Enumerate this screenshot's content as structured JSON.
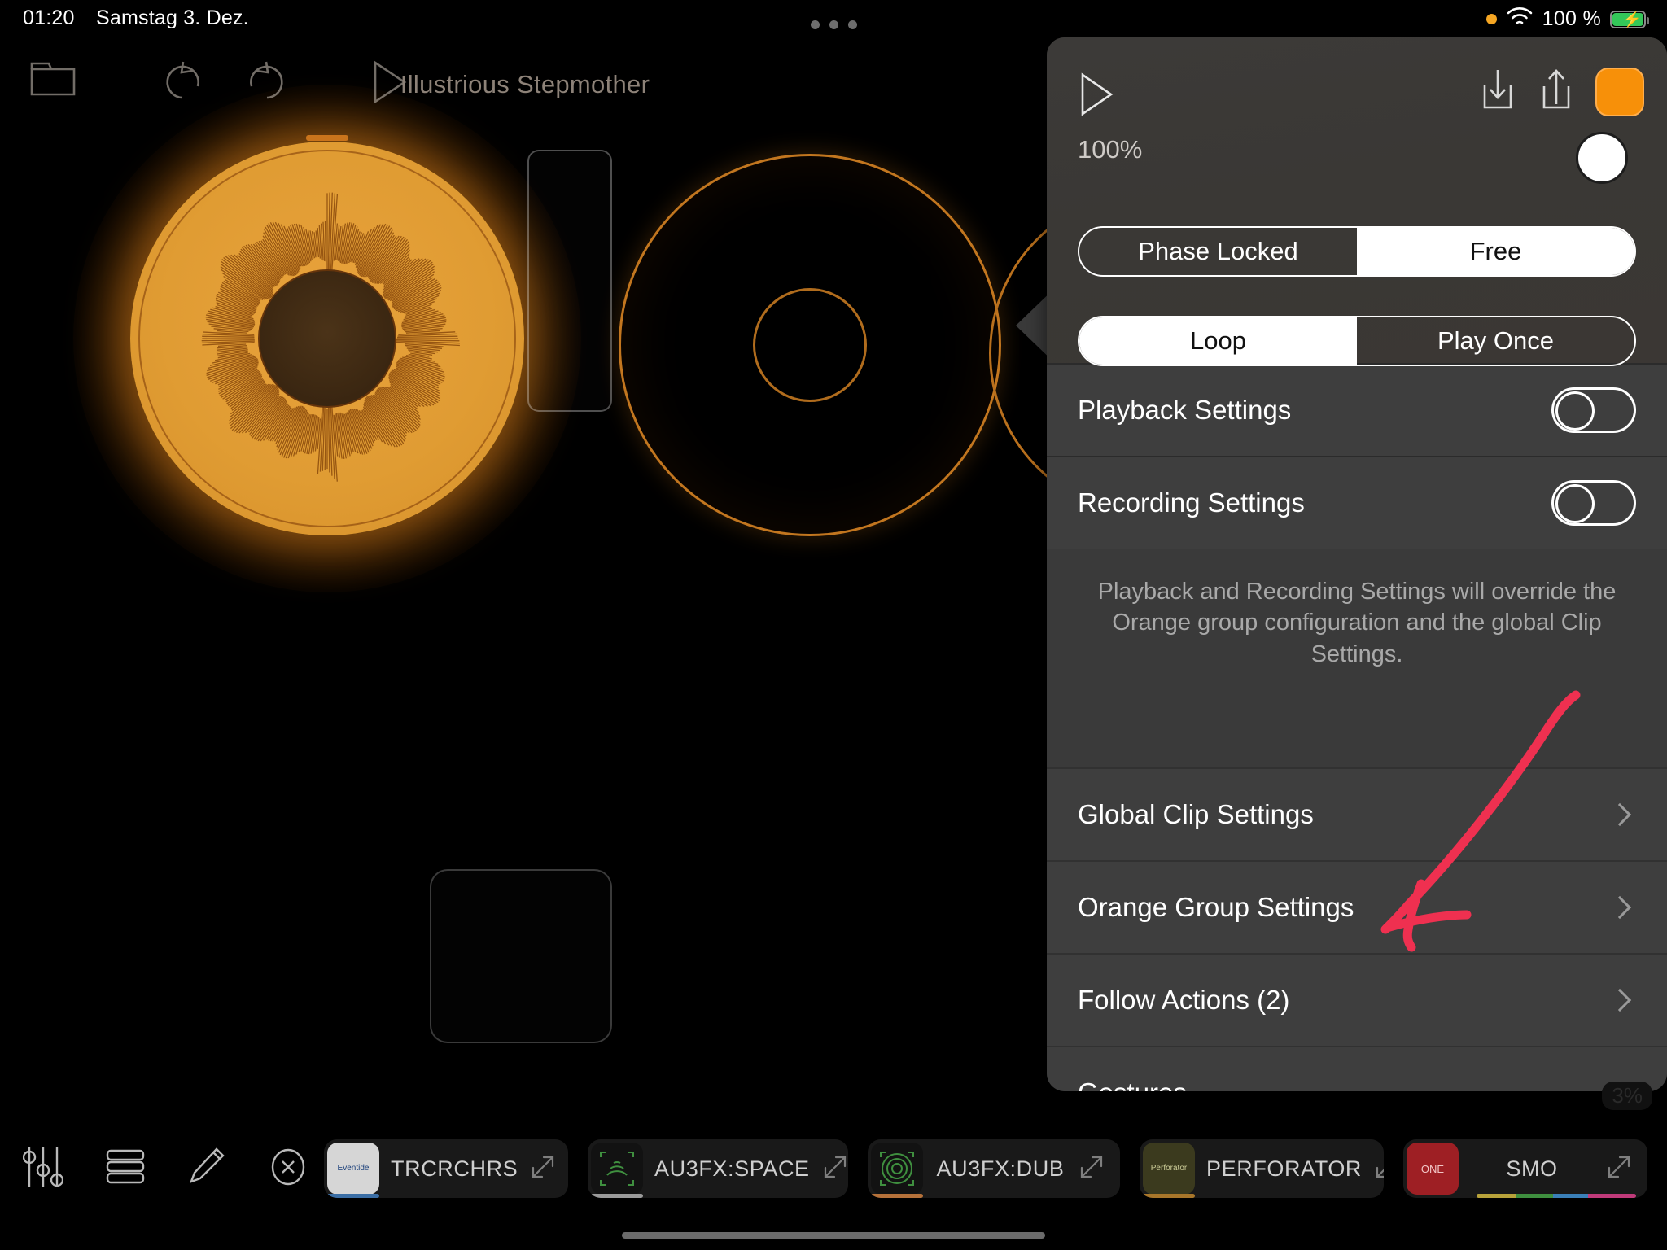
{
  "status_bar": {
    "time": "01:20",
    "date": "Samstag 3. Dez.",
    "battery_percent": "100 %",
    "battery_charging": true,
    "wifi_icon": "wifi-icon",
    "recording_dot_color": "#f5a623"
  },
  "app": {
    "title": "Illustrious Stepmother",
    "toolbar": {
      "folder_icon": "folder-icon",
      "undo_icon": "undo-icon",
      "redo_icon": "redo-icon",
      "play_icon": "play-icon"
    }
  },
  "panel": {
    "header": {
      "play_icon": "play-icon",
      "download_icon": "download-icon",
      "share_icon": "share-icon",
      "group_color_label": "orange-group-button",
      "group_color": "#f79009",
      "volume_percent": "100%",
      "knob_icon": "volume-knob"
    },
    "sync_segment": {
      "options": [
        "Phase Locked",
        "Free"
      ],
      "selected": "Free"
    },
    "play_segment": {
      "options": [
        "Loop",
        "Play Once"
      ],
      "selected": "Loop"
    },
    "toggles": [
      {
        "label": "Playback Settings",
        "on": false
      },
      {
        "label": "Recording Settings",
        "on": false
      }
    ],
    "note": "Playback and Recording Settings will override the Orange group configuration and the global Clip Settings.",
    "list_rows": [
      {
        "label": "Global Clip Settings",
        "chevron": "chevron-right-icon"
      },
      {
        "label": "Orange Group Settings",
        "chevron": "chevron-right-icon"
      },
      {
        "label": "Follow Actions  (2)",
        "chevron": "chevron-right-icon"
      },
      {
        "label": "Gestures",
        "chevron": "chevron-right-icon"
      }
    ]
  },
  "annotation": {
    "type": "hand-drawn-arrow",
    "color": "#ef3050",
    "points_to": "Follow Actions  (2)"
  },
  "bottom_bar": {
    "icons": [
      {
        "name": "mixer-icon"
      },
      {
        "name": "list-icon"
      },
      {
        "name": "pencil-icon"
      },
      {
        "name": "close-circle-icon"
      }
    ],
    "plugins": [
      {
        "name": "TRCRCHRS",
        "badge": "Eventide",
        "badge_bg": "#d6d6d6",
        "badge_fg": "#1a3f7a",
        "underline": "#3b6ea5",
        "expand_icon": "expand-icon"
      },
      {
        "name": "AU3FX:SPACE",
        "badge": "",
        "badge_bg": "#121212",
        "badge_fg": "#3f7a3f",
        "underline": "#9a9a9a",
        "expand_icon": "expand-icon"
      },
      {
        "name": "AU3FX:DUB",
        "badge": "",
        "badge_bg": "#121212",
        "badge_fg": "#3f7a3f",
        "underline": "#b5713a",
        "expand_icon": "expand-icon"
      },
      {
        "name": "PERFORATOR",
        "badge": "Perforator",
        "badge_bg": "#3b3a1e",
        "badge_fg": "#cfcf9a",
        "underline": "#a8762a",
        "expand_icon": "expand-icon"
      },
      {
        "name": "SMO",
        "badge": "ONE",
        "badge_bg": "#9e1f24",
        "badge_fg": "#f2c5c5",
        "underline": "multi",
        "expand_icon": "expand-icon"
      }
    ],
    "cpu_badge": "3%"
  },
  "canvas": {
    "clips": [
      {
        "name": "active-loop-clip",
        "state": "playing",
        "color": "#e9a23c"
      },
      {
        "name": "empty-loop-ring",
        "state": "empty",
        "color": "#c2761f"
      },
      {
        "name": "partial-loop-ring",
        "state": "empty",
        "color": "#b9701d"
      }
    ],
    "empty_slots": [
      "vertical-empty-slot",
      "square-empty-slot"
    ]
  }
}
